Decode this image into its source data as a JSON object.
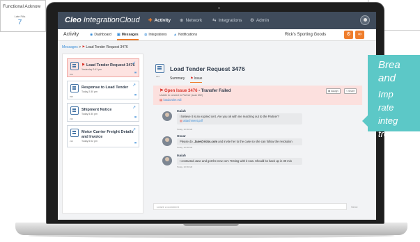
{
  "background": {
    "card_title": "Functional Acknow",
    "metric_label": "Late FAs",
    "metric_value": "7"
  },
  "app": {
    "logo_brand": "Cleo",
    "logo_product": "IntegrationCloud",
    "nav": [
      "Activity",
      "Network",
      "Integrations",
      "Admin"
    ],
    "customer": "Rick's Sporting Goods"
  },
  "subnav": {
    "title": "Activity",
    "items": [
      "Dashboard",
      "Messages",
      "Integrations",
      "Notifications"
    ]
  },
  "breadcrumb": {
    "root": "Messages",
    "sep": ">",
    "current": "Load Tender Request 3476"
  },
  "cards": [
    {
      "title": "Load Tender Request 3476",
      "time": "Yesterday 2:41 pm",
      "code": "204"
    },
    {
      "title": "Response to Load Tender",
      "time": "Today 2:30 pm",
      "code": "990"
    },
    {
      "title": "Shipment Notice",
      "time": "Today 5:30 pm",
      "code": "214"
    },
    {
      "title": "Motor Carrier Freight Details and Invoice",
      "time": "Today 6:02 pm",
      "code": "210"
    }
  ],
  "detail": {
    "title": "Load Tender Request 3476",
    "code": "204",
    "tabs": [
      "Summary",
      "Issue"
    ],
    "issue_id": "Open Issue 3476",
    "issue_text": " - Transfer Failed",
    "issue_sub": "Unable to connect to Partner (scan 652)",
    "issue_file": "loadorder.edi",
    "btn_assign": "Assign",
    "btn_share": "Share"
  },
  "messages": [
    {
      "author": "Isaiah",
      "text": "I believe it is an expired cert. Are you ok with me reaching out to the Partner?",
      "attachment": "attachment.pdf",
      "time": "Today, 10:36 AM"
    },
    {
      "author": "Oscar",
      "text_pre": "Please do. ",
      "email": "Jane@ricks.com",
      "text_post": " and invite her to the case so she can follow the resolution",
      "time": "Today, 10:36 AM"
    },
    {
      "author": "Isaiah",
      "text": "I contacted Jane and got the new cert. Testing with it now. Should be back up in 30 min",
      "time": "Today, 10:36 AM"
    }
  ],
  "composer": {
    "placeholder": "Leave a comment",
    "send": "Send"
  },
  "callout": {
    "line1": "Brea",
    "line2": "and",
    "line3": "Imp",
    "line4": "rate",
    "line5": "integ",
    "line6": "trou"
  },
  "colors": {
    "accent": "#ef7d2b",
    "topbar": "#3f4b5b",
    "callout": "#5cc8c7",
    "issue_bg": "#fce0de"
  }
}
